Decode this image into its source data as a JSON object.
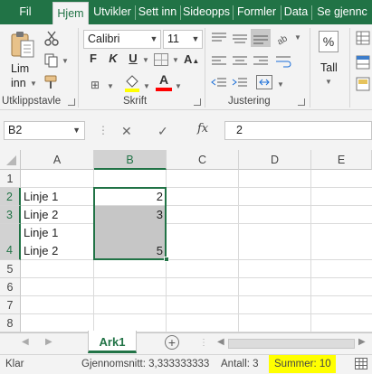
{
  "tabs": [
    "Fil",
    "Hjem",
    "Utvikler",
    "Sett inn",
    "Sideopps",
    "Formler",
    "Data",
    "Se gjennc"
  ],
  "active_tab": "Hjem",
  "ribbon": {
    "clipboard": {
      "paste_label_line1": "Lim",
      "paste_label_line2": "inn",
      "group_label": "Utklippstavle"
    },
    "font": {
      "font_name": "Calibri",
      "font_size": "11",
      "bold": "F",
      "italic": "K",
      "underline": "U",
      "group_label": "Skrift",
      "fill_color": "#ffff00",
      "font_color": "#ff0000"
    },
    "alignment": {
      "group_label": "Justering"
    },
    "number": {
      "format_label": "Tall",
      "percent": "%"
    }
  },
  "formula_bar": {
    "name_box": "B2",
    "fx": "fx",
    "value": "2"
  },
  "columns": [
    "A",
    "B",
    "C",
    "D",
    "E"
  ],
  "selected_column": "B",
  "rows": [
    "1",
    "2",
    "3",
    "",
    "4",
    "5",
    "6",
    "7",
    "8"
  ],
  "cells": {
    "A2": "Linje 1",
    "A3": "Linje 2",
    "A3b": "Linje 1",
    "A4": "Linje 2",
    "B2": "2",
    "B3": "3",
    "B4": "5"
  },
  "sheet_tabs": [
    "Ark1"
  ],
  "status_bar": {
    "ready": "Klar",
    "average": "Gjennomsnitt: 3,333333333",
    "count": "Antall: 3",
    "sum": "Summer: 10",
    "sum_highlight": "#ffff00"
  },
  "colors": {
    "accent": "#217346",
    "selection_fill": "#c6c6c6"
  }
}
